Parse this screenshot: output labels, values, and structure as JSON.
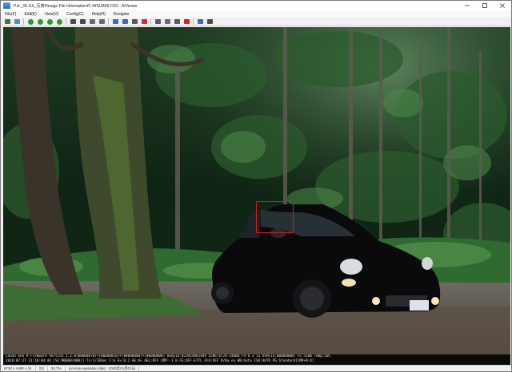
{
  "window": {
    "title": "P.A._06.GX_写真¥Image File Information¥1.4¥SUB99.CR3 - AIViewer"
  },
  "menu": {
    "items": [
      "File(F)",
      "Edit(E)",
      "View(V)",
      "Config(C)",
      "Help(H)",
      "Designer"
    ]
  },
  "toolbar": {
    "buttons": [
      {
        "icon": "open-icon",
        "color": "#3b7a3b"
      },
      {
        "icon": "image-icon",
        "color": "#4a8fd8"
      },
      {
        "icon": "first-icon",
        "color": "#2a9a2a"
      },
      {
        "icon": "prev-icon",
        "color": "#2a9a2a"
      },
      {
        "icon": "next-icon",
        "color": "#2a9a2a"
      },
      {
        "icon": "last-icon",
        "color": "#2a9a2a"
      },
      {
        "icon": "zoom-fit-icon",
        "color": "#4a4a4a"
      },
      {
        "icon": "zoom-actual-icon",
        "color": "#4a4a4a"
      },
      {
        "icon": "rotate-left-icon",
        "color": "#6a6a6a"
      },
      {
        "icon": "rotate-right-icon",
        "color": "#6a6a6a"
      },
      {
        "icon": "info-icon",
        "color": "#3a6ad0"
      },
      {
        "icon": "histogram-icon",
        "color": "#3a6ad0"
      },
      {
        "icon": "grid-icon",
        "color": "#5a5a5a"
      },
      {
        "icon": "color-icon",
        "color": "#d03030"
      },
      {
        "icon": "crop-icon",
        "color": "#5a5a5a"
      },
      {
        "icon": "settings-icon",
        "color": "#6a6a6a"
      },
      {
        "icon": "print-icon",
        "color": "#5a5a5a"
      },
      {
        "icon": "stop-icon",
        "color": "#d82020"
      },
      {
        "icon": "help-icon",
        "color": "#3a6ad0"
      },
      {
        "icon": "fullscreen-icon",
        "color": "#4a4a4a"
      }
    ]
  },
  "exif": {
    "line1": "Canon EOS R  Firmware Version 1.2.0[0000007B]+[00000010]+[00000000]+[00000000]  BodyID:023924001409  LENS:EF24-240mm F4-6.3 IS USM[IS:00000000]  FL:51mm  Temp:20C",
    "line2": "2018:07:27 11:18:04:44  [SC:N0000(000)]  Tv:1/20Sec  F:6  Ev:0.2  AE:Av  AEL:OFF  CMP:-1.0  FE:OFF-ETTL  AlO:OFF  R/Ko.ev  WB:Auto  ISO:AUTO  PS:Standard[CMP+0:4]"
  },
  "status": {
    "size": "6720 x 4480 x 24",
    "index": "2/3",
    "zoom": "33.7%",
    "license": "License expiration date : 2020年01月01日"
  },
  "viewport": {
    "selection_color": "#d81818"
  }
}
